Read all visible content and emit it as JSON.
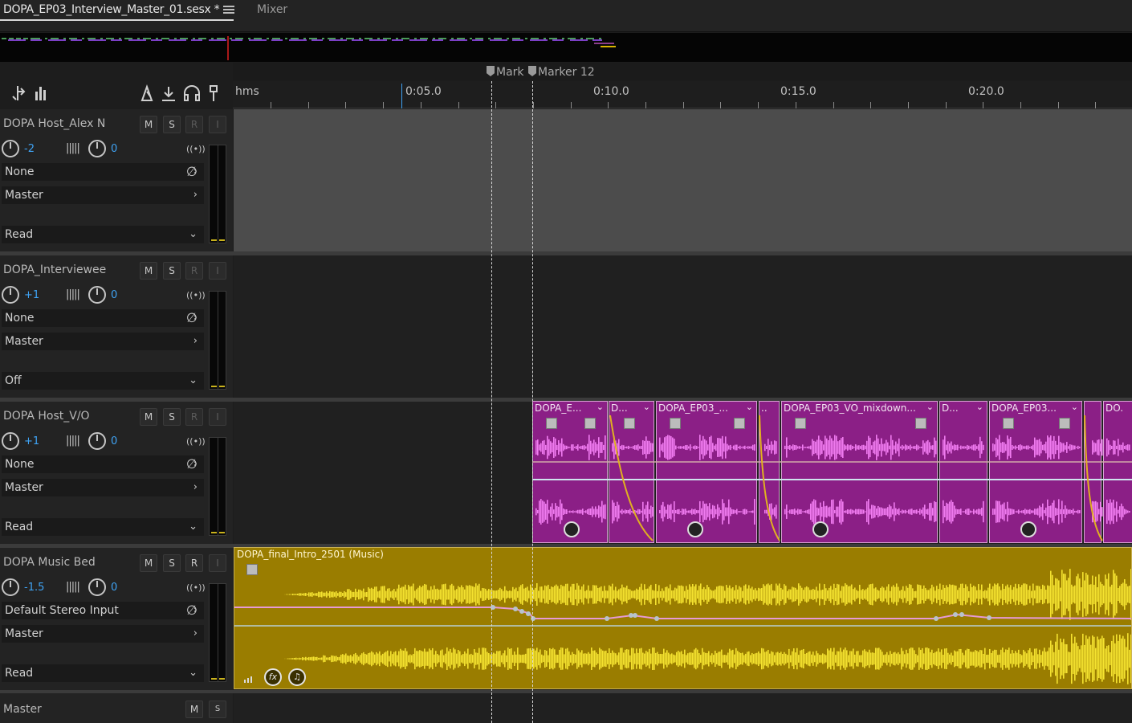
{
  "tabs": {
    "active_label": "DOPA_EP03_Interview_Master_01.sesx *",
    "mixer_label": "Mixer"
  },
  "markers": [
    {
      "label": "Mark"
    },
    {
      "label": "Marker 12"
    }
  ],
  "ruler": {
    "unit_label": "hms",
    "ticks": [
      "0:05.0",
      "0:10.0",
      "0:15.0",
      "0:20.0"
    ]
  },
  "tracks": [
    {
      "name": "DOPA Host_Alex N",
      "volume": "-2",
      "pan": "0",
      "input": "None",
      "output": "Master",
      "automation": "Read",
      "buttons": [
        "M",
        "S",
        "R",
        "I"
      ]
    },
    {
      "name": "DOPA_Interviewee",
      "volume": "+1",
      "pan": "0",
      "input": "None",
      "output": "Master",
      "automation": "Off",
      "buttons": [
        "M",
        "S",
        "R",
        "I"
      ]
    },
    {
      "name": "DOPA Host_V/O",
      "volume": "+1",
      "pan": "0",
      "input": "None",
      "output": "Master",
      "automation": "Read",
      "buttons": [
        "M",
        "S",
        "R",
        "I"
      ]
    },
    {
      "name": "DOPA Music Bed",
      "volume": "-1.5",
      "pan": "0",
      "input": "Default Stereo Input",
      "output": "Master",
      "automation": "Read",
      "buttons": [
        "M",
        "S",
        "R",
        "I"
      ]
    }
  ],
  "master_track": {
    "name": "Master",
    "buttons": [
      "M",
      "S"
    ]
  },
  "vo_clips": [
    {
      "label": "DOPA_E..."
    },
    {
      "label": "D..."
    },
    {
      "label": "DOPA_EP03_..."
    },
    {
      "label": "..."
    },
    {
      "label": "DOPA_EP03_VO_mixdown..."
    },
    {
      "label": "D..."
    },
    {
      "label": "DOPA_EP03..."
    },
    {
      "label": ""
    },
    {
      "label": "DO..."
    }
  ],
  "music_clip": {
    "label": "DOPA_final_Intro_2501 (Music)",
    "fx_label": "fx"
  },
  "colors": {
    "vo_clip": "#8b1f86",
    "vo_wave": "#f07cf0",
    "music_clip": "#9a7d00",
    "music_wave": "#f4e230",
    "fade_curve": "#e0b020",
    "volume_env": "#e69ad6",
    "accent_blue": "#3fa3f4"
  },
  "icons": [
    "menu-icon",
    "snap-icon",
    "frequency-icon",
    "metronome-icon",
    "punch-icon",
    "headphones-icon",
    "marker-pin-icon",
    "knob-icon",
    "meter-icon",
    "broadcast-icon",
    "phase-invert-icon",
    "chevron-right-icon",
    "chevron-down-icon",
    "fx-icon",
    "note-icon"
  ]
}
